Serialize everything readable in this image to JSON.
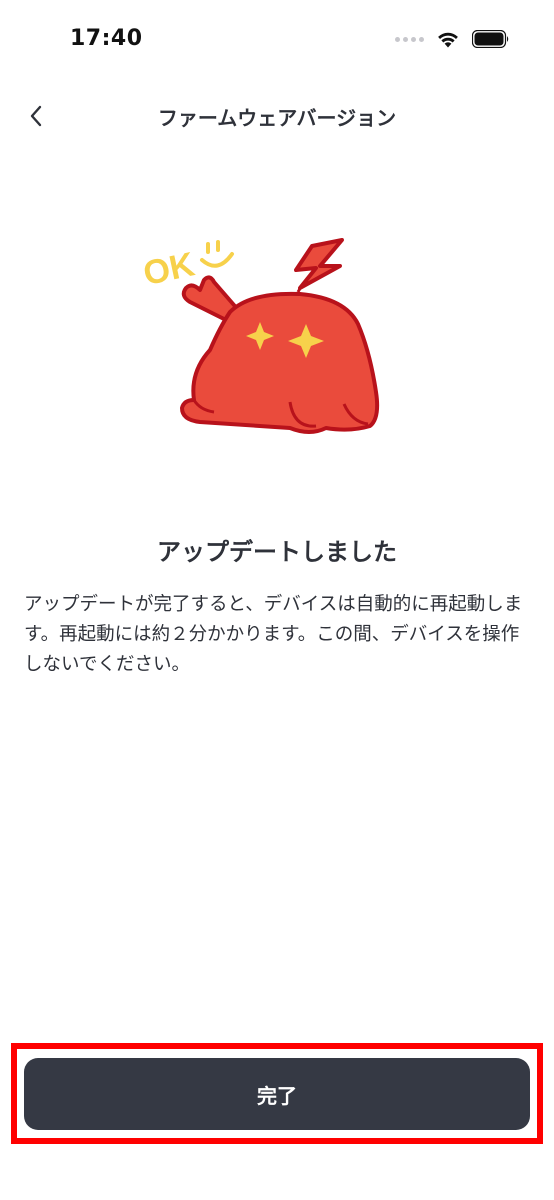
{
  "status_bar": {
    "time": "17:40"
  },
  "header": {
    "title": "ファームウェアバージョン"
  },
  "illustration": {
    "ok_text": "OK",
    "main_color": "#ea4b3c",
    "accent_color": "#f7d14b"
  },
  "main": {
    "heading": "アップデートしました",
    "description": "アップデートが完了すると、デバイスは自動的に再起動します。再起動には約２分かかります。この間、デバイスを操作しないでください。"
  },
  "footer": {
    "done_label": "完了"
  }
}
